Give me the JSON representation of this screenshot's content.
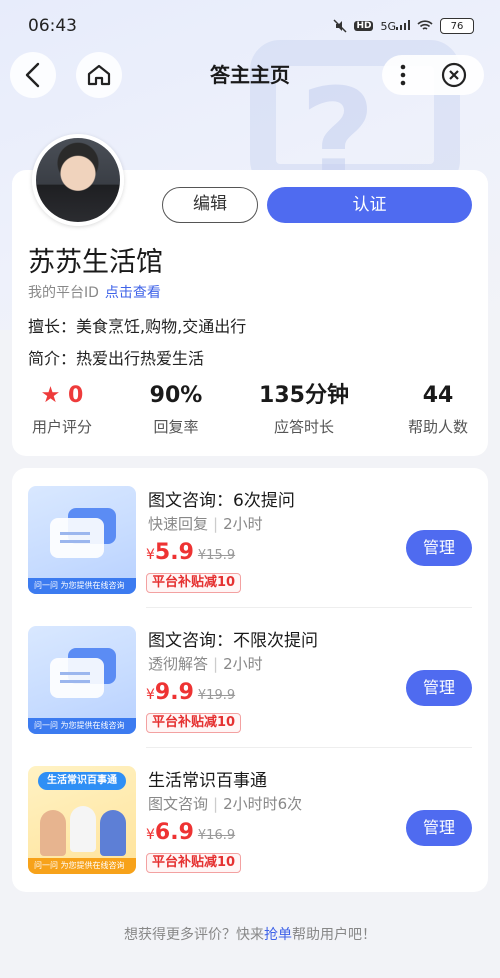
{
  "status": {
    "time": "06:43",
    "battery": "76",
    "hd": "HD",
    "signal": "5G"
  },
  "nav": {
    "title": "答主主页"
  },
  "profile": {
    "name": "苏苏生活馆",
    "id_label": "我的平台ID",
    "id_link": "点击查看",
    "edit_label": "编辑",
    "cert_label": "认证",
    "skill_prefix": "擅长：",
    "skill": "美食烹饪,购物,交通出行",
    "intro_prefix": "简介：",
    "intro": "热爱出行热爱生活"
  },
  "stats": [
    {
      "value": "0",
      "label": "用户评分"
    },
    {
      "value": "90%",
      "label": "回复率"
    },
    {
      "value": "135分钟",
      "label": "应答时长"
    },
    {
      "value": "44",
      "label": "帮助人数"
    }
  ],
  "services": [
    {
      "title": "图文咨询：6次提问",
      "tag1": "快速回复",
      "tag2": "2小时",
      "currency": "¥",
      "price": "5.9",
      "old_price": "¥15.9",
      "badge": "平台补贴减10",
      "button": "管理",
      "thumb_brand": "问一问",
      "thumb_caption": "为您提供在线咨询"
    },
    {
      "title": "图文咨询：不限次提问",
      "tag1": "透彻解答",
      "tag2": "2小时",
      "currency": "¥",
      "price": "9.9",
      "old_price": "¥19.9",
      "badge": "平台补贴减10",
      "button": "管理",
      "thumb_brand": "问一问",
      "thumb_caption": "为您提供在线咨询"
    },
    {
      "title": "生活常识百事通",
      "tag1": "图文咨询",
      "tag2": "2小时时6次",
      "currency": "¥",
      "price": "6.9",
      "old_price": "¥16.9",
      "badge": "平台补贴减10",
      "button": "管理",
      "thumb_brand": "问一问",
      "thumb_caption": "为您提供在线咨询",
      "thumb_title": "生活常识百事通"
    }
  ],
  "footer": {
    "prefix": "想获得更多评价？快来",
    "link": "抢单",
    "suffix": "帮助用户吧！"
  },
  "colors": {
    "accent": "#4f6bf0",
    "price": "#ee3333",
    "link": "#3f63e8"
  }
}
